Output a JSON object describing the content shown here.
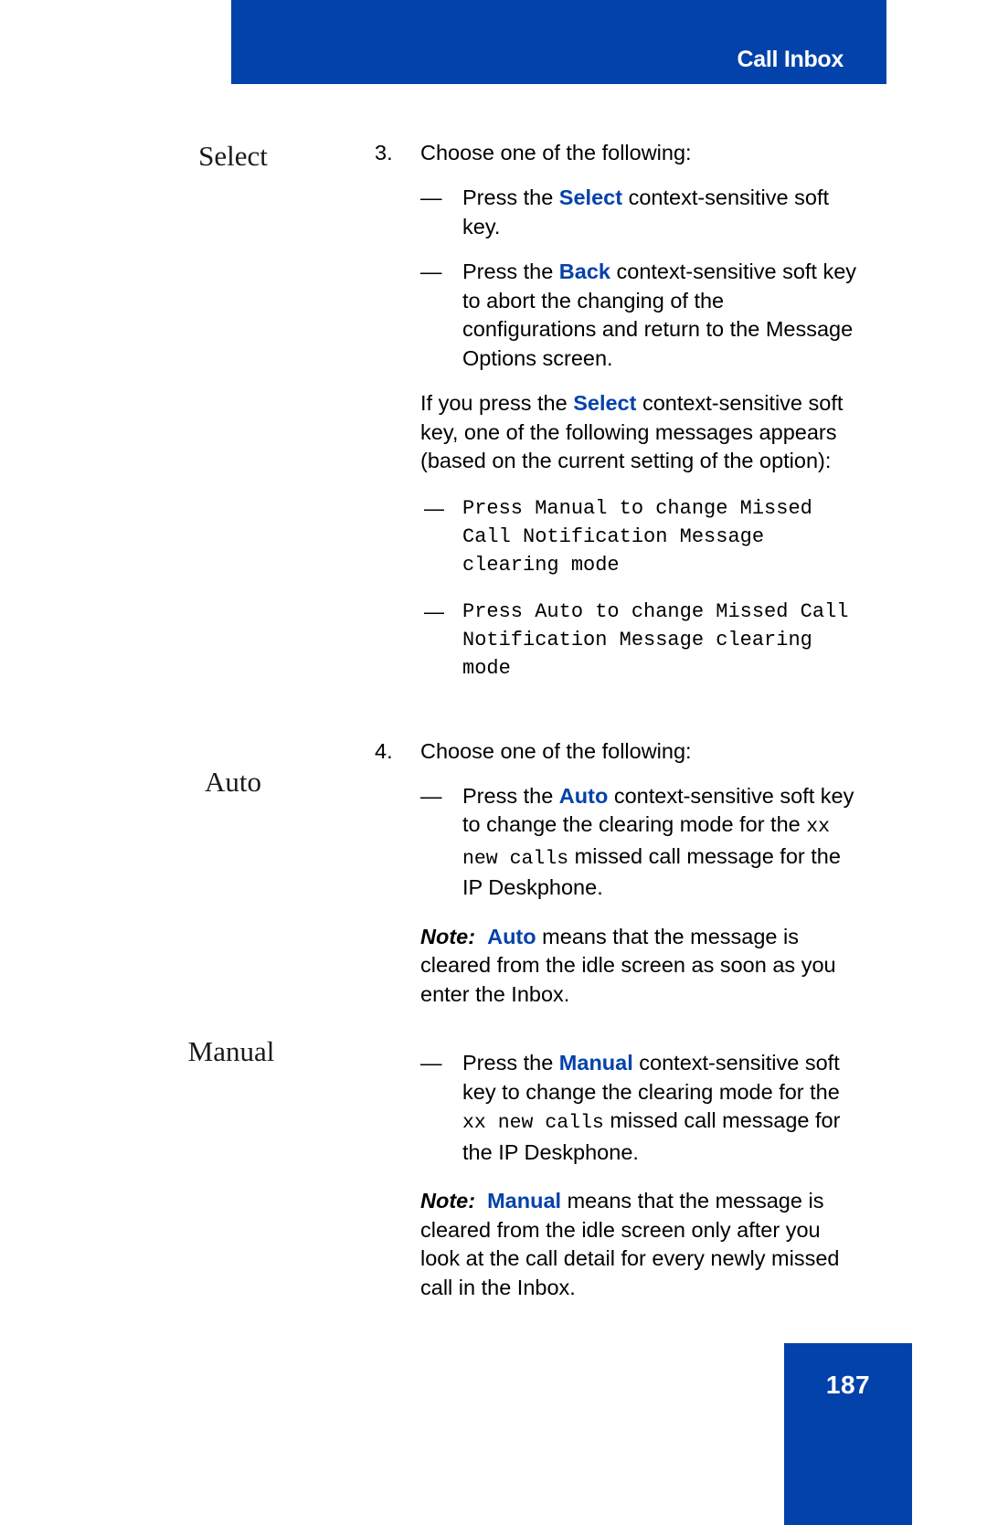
{
  "header": {
    "title": "Call Inbox",
    "bar_color": "#0342ab"
  },
  "margin_labels": {
    "select": "Select",
    "auto": "Auto",
    "manual": "Manual"
  },
  "steps": [
    {
      "number": "3.",
      "text": "Choose one of the following:",
      "bullets": [
        {
          "mark": "—",
          "pre": "Press the ",
          "keyword": "Select",
          "post": " context-sensitive soft key."
        },
        {
          "mark": "—",
          "pre": "Press the ",
          "keyword": "Back",
          "post": " context-sensitive soft key to abort the changing of the configurations and return to the Message Options screen."
        }
      ],
      "paragraph": {
        "pre": "If you press the ",
        "keyword": "Select",
        "post": " context-sensitive soft key, one of the following messages appears (based on the current setting of the option):"
      },
      "mono_items": [
        {
          "mark": "—",
          "text": "Press Manual to change Missed Call Notification Message clearing mode"
        },
        {
          "mark": "—",
          "text": "Press Auto to change Missed Call Notification Message clearing mode"
        }
      ]
    },
    {
      "number": "4.",
      "text": "Choose one of the following:",
      "bullets": [
        {
          "mark": "—",
          "pre": "Press the ",
          "keyword": "Auto",
          "mid": " context-sensitive soft key to change the clearing mode for the ",
          "mono": "xx new calls",
          "post": " missed call message for the IP Deskphone."
        },
        {
          "mark": "—",
          "pre": "Press the ",
          "keyword": "Manual",
          "mid": " context-sensitive soft key to change the clearing mode for the ",
          "mono": "xx new calls",
          "post": " missed call message for the IP Deskphone."
        }
      ],
      "notes": [
        {
          "lead": "Note:",
          "keyword": "Auto",
          "text": " means that the message is cleared from the idle screen as soon as you enter the Inbox."
        },
        {
          "lead": "Note:",
          "keyword": "Manual",
          "text": " means that the message is cleared from the idle screen only after you look at the call detail for every newly missed call in the Inbox."
        }
      ]
    }
  ],
  "footer": {
    "page_number": "187",
    "box_color": "#0342ab"
  },
  "colors": {
    "keyword_blue": "#0342ab",
    "body_text": "#000000"
  }
}
